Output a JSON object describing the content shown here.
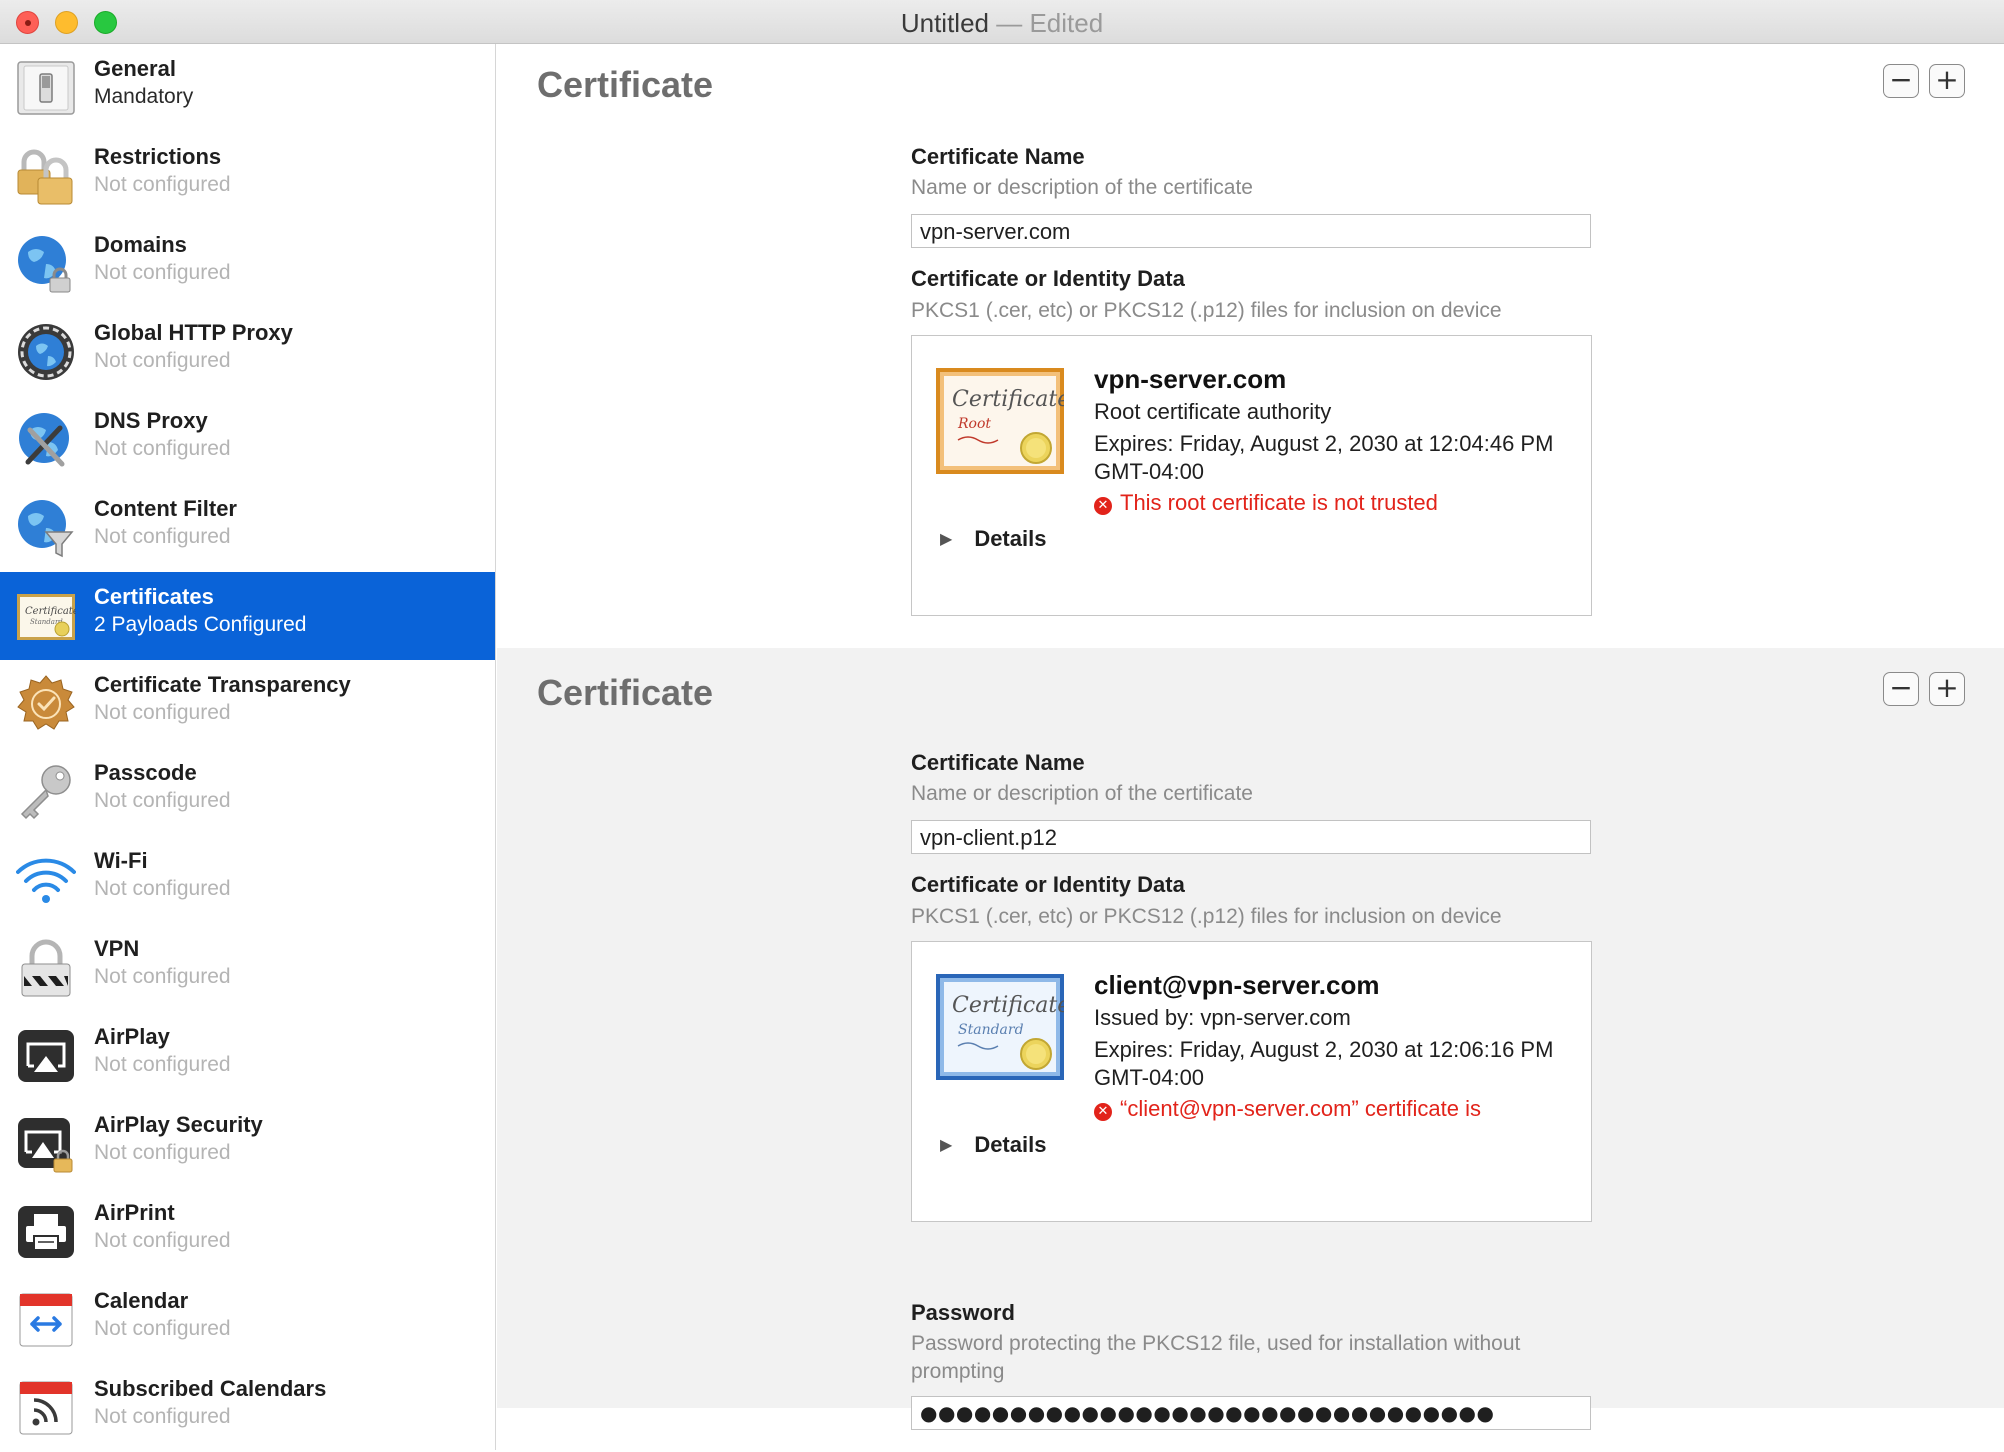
{
  "window": {
    "title": "Untitled",
    "separator": " — ",
    "status": "Edited"
  },
  "sidebar": {
    "items": [
      {
        "title": "General",
        "subtitle": "Mandatory",
        "icon": "switch-icon"
      },
      {
        "title": "Restrictions",
        "subtitle": "Not configured",
        "icon": "padlocks-icon"
      },
      {
        "title": "Domains",
        "subtitle": "Not configured",
        "icon": "globe-lock-icon"
      },
      {
        "title": "Global HTTP Proxy",
        "subtitle": "Not configured",
        "icon": "globe-proxy-icon"
      },
      {
        "title": "DNS Proxy",
        "subtitle": "Not configured",
        "icon": "globe-tools-icon"
      },
      {
        "title": "Content Filter",
        "subtitle": "Not configured",
        "icon": "globe-funnel-icon"
      },
      {
        "title": "Certificates",
        "subtitle": "2 Payloads Configured",
        "icon": "certificate-icon",
        "selected": true
      },
      {
        "title": "Certificate Transparency",
        "subtitle": "Not configured",
        "icon": "seal-badge-icon"
      },
      {
        "title": "Passcode",
        "subtitle": "Not configured",
        "icon": "key-icon"
      },
      {
        "title": "Wi-Fi",
        "subtitle": "Not configured",
        "icon": "wifi-icon"
      },
      {
        "title": "VPN",
        "subtitle": "Not configured",
        "icon": "vpn-lock-icon"
      },
      {
        "title": "AirPlay",
        "subtitle": "Not configured",
        "icon": "airplay-icon"
      },
      {
        "title": "AirPlay Security",
        "subtitle": "Not configured",
        "icon": "airplay-lock-icon"
      },
      {
        "title": "AirPrint",
        "subtitle": "Not configured",
        "icon": "printer-icon"
      },
      {
        "title": "Calendar",
        "subtitle": "Not configured",
        "icon": "calendar-icon"
      },
      {
        "title": "Subscribed Calendars",
        "subtitle": "Not configured",
        "icon": "calendar-rss-icon"
      }
    ]
  },
  "certificates": [
    {
      "section_title": "Certificate",
      "name_label": "Certificate Name",
      "name_desc": "Name or description of the certificate",
      "name_value": "vpn-server.com",
      "data_label": "Certificate or Identity Data",
      "data_desc": "PKCS1 (.cer, etc) or PKCS12 (.p12) files for inclusion on device",
      "cert_title": "vpn-server.com",
      "cert_line1": "Root certificate authority",
      "cert_expires": "Expires: Friday, August 2, 2030 at 12:04:46 PM GMT-04:00",
      "cert_error": "This root certificate is not trusted",
      "cert_image_word": "Certificate",
      "cert_image_sub": "Root",
      "details_label": "Details"
    },
    {
      "section_title": "Certificate",
      "name_label": "Certificate Name",
      "name_desc": "Name or description of the certificate",
      "name_value": "vpn-client.p12",
      "data_label": "Certificate or Identity Data",
      "data_desc": "PKCS1 (.cer, etc) or PKCS12 (.p12) files for inclusion on device",
      "cert_title": "client@vpn-server.com",
      "cert_line1": "Issued by: vpn-server.com",
      "cert_expires": "Expires: Friday, August 2, 2030 at 12:06:16 PM GMT-04:00",
      "cert_error": "“client@vpn-server.com” certificate is",
      "cert_image_word": "Certificate",
      "cert_image_sub": "Standard",
      "details_label": "Details",
      "password_label": "Password",
      "password_desc": "Password protecting the PKCS12 file, used for installation without prompting",
      "password_value": "●●●●●●●●●●●●●●●●●●●●●●●●●●●●●●●●"
    }
  ],
  "buttons": {
    "remove_symbol": "−",
    "add_symbol": "+",
    "disclosure": "▶",
    "error_symbol": "✕"
  },
  "colors": {
    "selection": "#0a63d8",
    "error": "#e2231a",
    "root_cert_frame": "#d98a1e",
    "standard_cert_frame": "#2a66b8"
  }
}
